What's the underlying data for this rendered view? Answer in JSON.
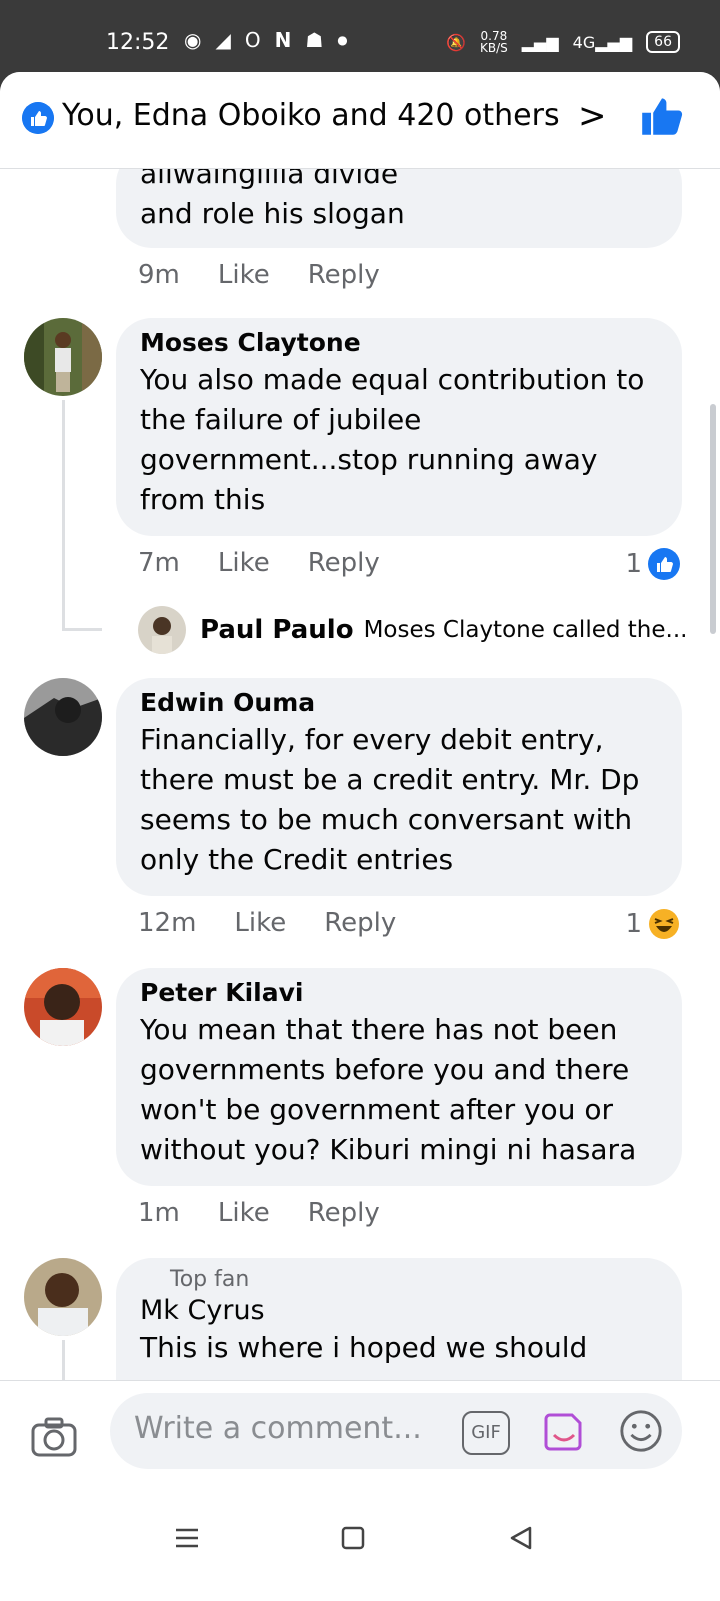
{
  "status_bar": {
    "time": "12:52",
    "net_speed": "0.78",
    "net_unit": "KB/S",
    "battery": "66"
  },
  "header": {
    "reactors": "You, Edna Oboiko and 420 others"
  },
  "comments": [
    {
      "author": "",
      "text": "aliwaingilila divide and role his slogan",
      "time": "9m",
      "like": "Like",
      "reply": "Reply"
    },
    {
      "author": "Moses Claytone",
      "text": "You also made equal contribution to the failure of jubilee government...stop running away from this",
      "time": "7m",
      "like": "Like",
      "reply": "Reply",
      "reaction_count": "1"
    },
    {
      "author": "Edwin Ouma",
      "text": "Financially, for every debit entry, there must be a credit entry.  Mr. Dp seems to be much conversant with only the Credit entries",
      "time": "12m",
      "like": "Like",
      "reply": "Reply",
      "reaction_count": "1"
    },
    {
      "author": "Peter Kilavi",
      "text": "You mean that there has not been governments before you and there won't be government after you or without you? Kiburi mingi ni hasara",
      "time": "1m",
      "like": "Like",
      "reply": "Reply"
    },
    {
      "badge": "Top fan",
      "author": "Mk Cyrus",
      "text": "This is where i hoped we should"
    }
  ],
  "reply_preview": {
    "author": "Paul Paulo",
    "text": "Moses Claytone called the..."
  },
  "composer": {
    "placeholder": "Write a comment...",
    "gif": "GIF"
  },
  "colors": {
    "accent": "#1877f2",
    "bubble": "#f0f2f5",
    "meta": "#65676b"
  }
}
